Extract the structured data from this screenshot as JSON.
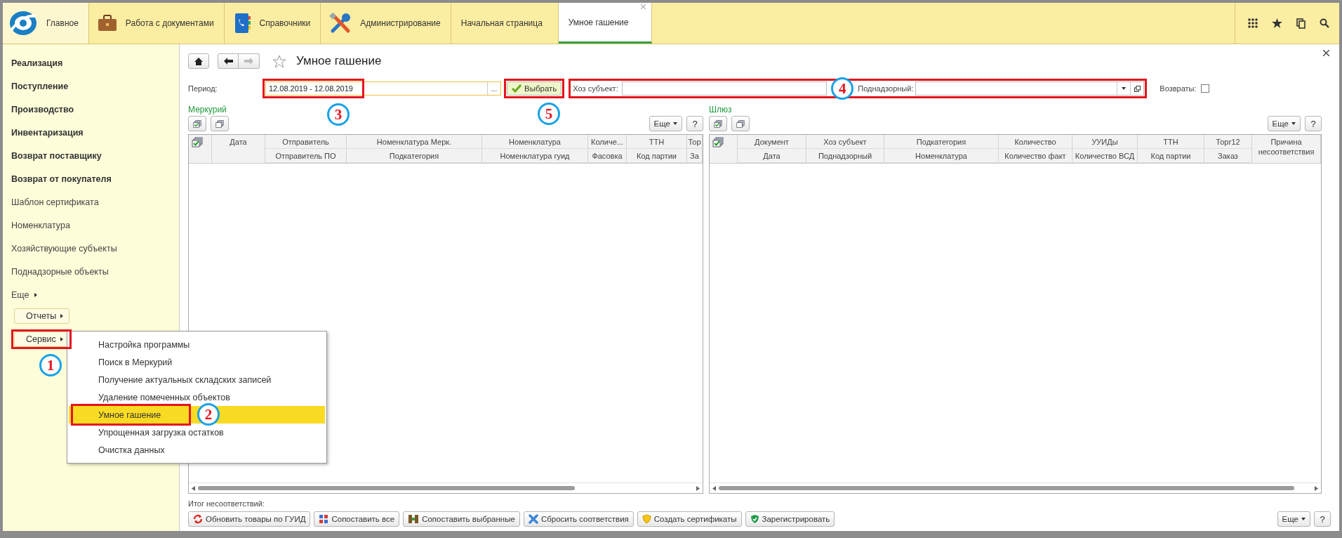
{
  "top_bar": {
    "sections": [
      {
        "kind": "home",
        "label": "Главное",
        "selected": true
      },
      {
        "kind": "documents",
        "label": "Работа с документами",
        "selected": false
      },
      {
        "kind": "directory",
        "label": "Справочники",
        "selected": false
      },
      {
        "kind": "admin",
        "label": "Администрирование",
        "selected": false
      }
    ],
    "open_tabs": [
      {
        "label": "Начальная страница",
        "selected": false,
        "closable": false
      },
      {
        "label": "Умное гашение",
        "selected": true,
        "closable": true
      }
    ]
  },
  "sidebar": {
    "items": [
      {
        "label": "Реализация",
        "bold": true
      },
      {
        "label": "Поступление",
        "bold": true
      },
      {
        "label": "Производство",
        "bold": true
      },
      {
        "label": "Инвентаризация",
        "bold": true
      },
      {
        "label": "Возврат поставщику",
        "bold": true
      },
      {
        "label": "Возврат от покупателя",
        "bold": true
      },
      {
        "label": "Шаблон сертификата",
        "bold": false
      },
      {
        "label": "Номенклатура",
        "bold": false
      },
      {
        "label": "Хозяйствующие субъекты",
        "bold": false
      },
      {
        "label": "Поднадзорные объекты",
        "bold": false
      }
    ],
    "more": "Еще",
    "buttons": [
      "Отчеты",
      "Сервис"
    ]
  },
  "menu": {
    "items": [
      {
        "label": "Настройка программы",
        "selected": false
      },
      {
        "label": "Поиск в Меркурий",
        "selected": false
      },
      {
        "label": "Получение актуальных складских записей",
        "selected": false
      },
      {
        "label": "Удаление помеченных объектов",
        "selected": false
      },
      {
        "label": "Умное гашение",
        "selected": true
      },
      {
        "label": "Упрощенная загрузка остатков",
        "selected": false
      },
      {
        "label": "Очистка данных",
        "selected": false
      }
    ]
  },
  "form": {
    "title": "Умное гашение",
    "period_label": "Период:",
    "period_value": "12.08.2019 - 12.08.2019",
    "choose_button": "...",
    "select_button": "Выбрать",
    "entity_label": "Хоз субъект:",
    "supervised_label": "Поднадзорный:",
    "returns_label": "Возвраты:",
    "returns_checked": false
  },
  "panels": [
    {
      "title": "Меркурий",
      "more_button": "Еще",
      "help_button": "?",
      "columns": [
        {
          "kind": "check"
        },
        {
          "kind": "tall",
          "label": "Дата"
        },
        {
          "kind": "pair",
          "top": "Отправитель",
          "bottom": "Отправитель ПО"
        },
        {
          "kind": "pair",
          "top": "Номенклатура Мерк.",
          "bottom": "Подкатегория"
        },
        {
          "kind": "pair",
          "top": "Номенклатура",
          "bottom": "Номенклатура гуид"
        },
        {
          "kind": "pair",
          "top": "Количе...",
          "bottom": "Фасовка"
        },
        {
          "kind": "pair",
          "top": "ТТН",
          "bottom": "Код партии"
        },
        {
          "kind": "pair",
          "top": "Тор",
          "bottom": "За"
        }
      ]
    },
    {
      "title": "Шлюз",
      "more_button": "Еще",
      "help_button": "?",
      "columns": [
        {
          "kind": "check"
        },
        {
          "kind": "pair",
          "top": "Документ",
          "bottom": "Дата"
        },
        {
          "kind": "pair",
          "top": "Хоз субъект",
          "bottom": "Поднадзорный"
        },
        {
          "kind": "pair",
          "top": "Подкатегория",
          "bottom": "Номенклатура"
        },
        {
          "kind": "pair",
          "top": "Количество",
          "bottom": "Количество факт"
        },
        {
          "kind": "pair",
          "top": "УУИДы",
          "bottom": "Количество ВСД"
        },
        {
          "kind": "pair",
          "top": "ТТН",
          "bottom": "Код партии"
        },
        {
          "kind": "pair",
          "top": "Торг12",
          "bottom": "Заказ"
        },
        {
          "kind": "tall",
          "label": "Причина несоответствия"
        }
      ]
    }
  ],
  "footer": {
    "label": "Итог несоответствий:",
    "buttons": [
      {
        "kind": "refresh",
        "label": "Обновить товары по ГУИД"
      },
      {
        "kind": "match-all",
        "label": "Сопоставить все"
      },
      {
        "kind": "match-selected",
        "label": "Сопоставить выбранные"
      },
      {
        "kind": "reset",
        "label": "Сбросить соответствия"
      },
      {
        "kind": "certificate",
        "label": "Создать сертификаты"
      },
      {
        "kind": "register",
        "label": "Зарегистрировать"
      }
    ],
    "more_button": "Еще",
    "help_button": "?"
  },
  "annotations": [
    {
      "label": "1"
    },
    {
      "label": "2"
    },
    {
      "label": "3"
    },
    {
      "label": "4"
    },
    {
      "label": "5"
    }
  ]
}
